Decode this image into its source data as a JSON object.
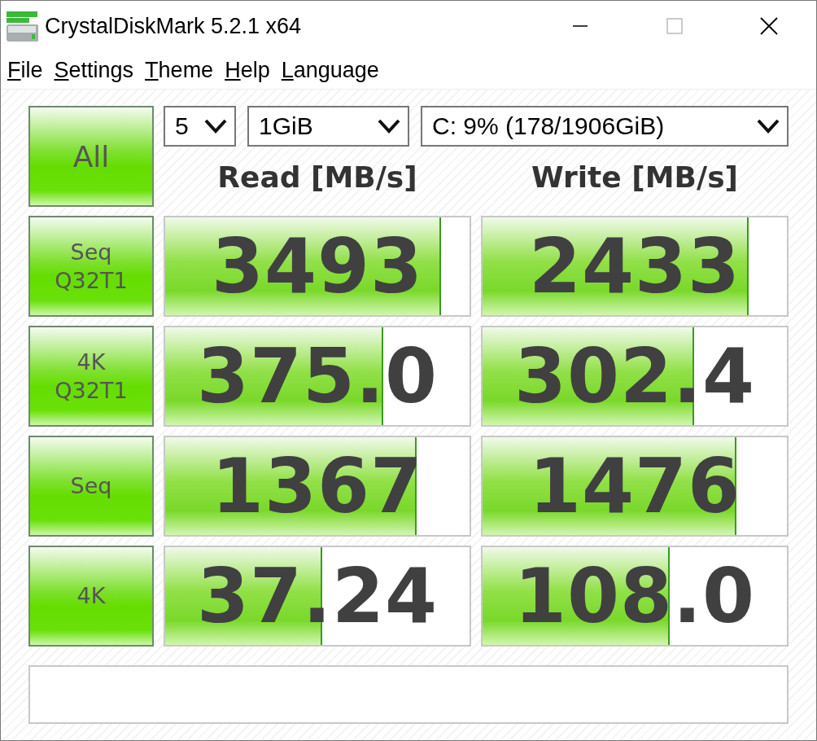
{
  "window": {
    "title": "CrystalDiskMark 5.2.1 x64"
  },
  "menu": [
    "File",
    "Settings",
    "Theme",
    "Help",
    "Language"
  ],
  "all_button": "All",
  "controls": {
    "count": "5",
    "size": "1GiB",
    "drive": "C: 9% (178/1906GiB)"
  },
  "headers": {
    "read": "Read [MB/s]",
    "write": "Write [MB/s]"
  },
  "rows": [
    {
      "label": "Seq\nQ32T1",
      "read": {
        "value": "3493",
        "level": 0.9
      },
      "write": {
        "value": "2433",
        "level": 0.87
      }
    },
    {
      "label": "4K\nQ32T1",
      "read": {
        "value": "375.0",
        "level": 0.71
      },
      "write": {
        "value": "302.4",
        "level": 0.69
      }
    },
    {
      "label": "Seq",
      "read": {
        "value": "1367",
        "level": 0.82
      },
      "write": {
        "value": "1476",
        "level": 0.83
      }
    },
    {
      "label": "4K",
      "read": {
        "value": "37.24",
        "level": 0.51
      },
      "write": {
        "value": "108.0",
        "level": 0.61
      }
    }
  ]
}
